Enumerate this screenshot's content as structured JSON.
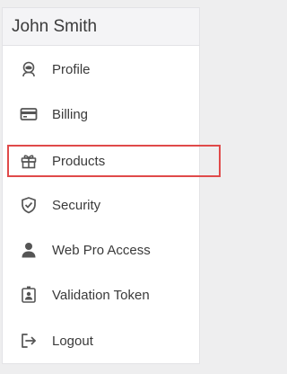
{
  "user": {
    "name": "John Smith"
  },
  "menu": {
    "items": [
      {
        "label": "Profile",
        "icon": "astronaut-icon"
      },
      {
        "label": "Billing",
        "icon": "credit-card-icon"
      },
      {
        "label": "Products",
        "icon": "gift-icon",
        "selected": true
      },
      {
        "label": "Security",
        "icon": "shield-check-icon"
      },
      {
        "label": "Web Pro Access",
        "icon": "user-icon"
      },
      {
        "label": "Validation Token",
        "icon": "id-badge-icon"
      },
      {
        "label": "Logout",
        "icon": "logout-icon"
      }
    ]
  },
  "colors": {
    "highlight_border": "#e04a4a",
    "header_bg": "#f4f4f6",
    "text": "#3a3a3a"
  }
}
